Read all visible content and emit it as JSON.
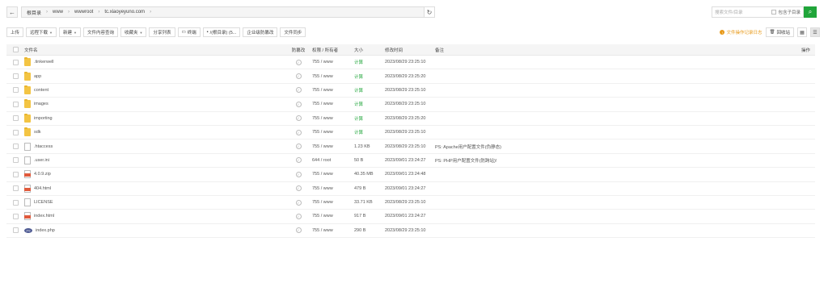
{
  "addressbar": {
    "back_icon": "←",
    "crumbs": [
      "根目录",
      "www",
      "wwwroot",
      "tc.xiaoyeyuno.com"
    ],
    "refresh_icon": "↻"
  },
  "search": {
    "placeholder": "搜索文件/目录",
    "subdir_label": "包含子目录",
    "button_icon": "⌕"
  },
  "toolbar": {
    "upload": "上传",
    "remote_download": "远程下载",
    "new": "新建",
    "content_search": "文件内容查询",
    "favorites": "收藏夹",
    "share_list": "分享列表",
    "terminal": "终端",
    "disk": "/(根目录) (5...",
    "enterprise_backup": "企业级防篡改",
    "file_sync": "文件同步"
  },
  "right_tools": {
    "notice": "文件操作记录日志",
    "recycle": "回收站"
  },
  "table": {
    "headers": {
      "name": "文件名",
      "protect": "防篡改",
      "perm": "权限 / 所有者",
      "size": "大小",
      "mtime": "修改时间",
      "note": "备注",
      "op": "操作"
    },
    "rows": [
      {
        "name": ".tinkerwell",
        "type": "folder",
        "perm": "755 / www",
        "size": "计算",
        "mtime": "2023/08/29 23:25:10",
        "note": ""
      },
      {
        "name": "app",
        "type": "folder",
        "perm": "755 / www",
        "size": "计算",
        "mtime": "2023/08/29 23:25:20",
        "note": ""
      },
      {
        "name": "content",
        "type": "folder",
        "perm": "755 / www",
        "size": "计算",
        "mtime": "2023/08/29 23:25:10",
        "note": ""
      },
      {
        "name": "images",
        "type": "folder",
        "perm": "755 / www",
        "size": "计算",
        "mtime": "2023/08/29 23:25:10",
        "note": ""
      },
      {
        "name": "importing",
        "type": "folder",
        "perm": "755 / www",
        "size": "计算",
        "mtime": "2023/08/29 23:25:20",
        "note": ""
      },
      {
        "name": "sdk",
        "type": "folder",
        "perm": "755 / www",
        "size": "计算",
        "mtime": "2023/08/29 23:25:10",
        "note": ""
      },
      {
        "name": ".htaccess",
        "type": "file",
        "perm": "755 / www",
        "size": "1.23 KB",
        "mtime": "2023/08/29 23:25:10",
        "note": "PS: Apache用户配置文件(伪静态)"
      },
      {
        "name": ".user.ini",
        "type": "file",
        "perm": "644 / root",
        "size": "50 B",
        "mtime": "2023/09/01 23:24:27",
        "note": "PS: PHP用户配置文件(防跨站)!"
      },
      {
        "name": "4.0.9.zip",
        "type": "red",
        "perm": "755 / www",
        "size": "40.35 MB",
        "mtime": "2023/09/01 23:24:48",
        "note": ""
      },
      {
        "name": "404.html",
        "type": "red",
        "perm": "755 / www",
        "size": "479 B",
        "mtime": "2023/09/01 23:24:27",
        "note": ""
      },
      {
        "name": "LICENSE",
        "type": "file",
        "perm": "755 / www",
        "size": "33.71 KB",
        "mtime": "2023/08/29 23:25:10",
        "note": ""
      },
      {
        "name": "index.html",
        "type": "red",
        "perm": "755 / www",
        "size": "917 B",
        "mtime": "2023/09/01 23:24:27",
        "note": ""
      },
      {
        "name": "index.php",
        "type": "php",
        "perm": "755 / www",
        "size": "290 B",
        "mtime": "2023/08/29 23:25:10",
        "note": ""
      }
    ]
  },
  "colors": {
    "accent": "#20a53a",
    "folder": "#f3c443",
    "warning": "#e89a1a"
  }
}
